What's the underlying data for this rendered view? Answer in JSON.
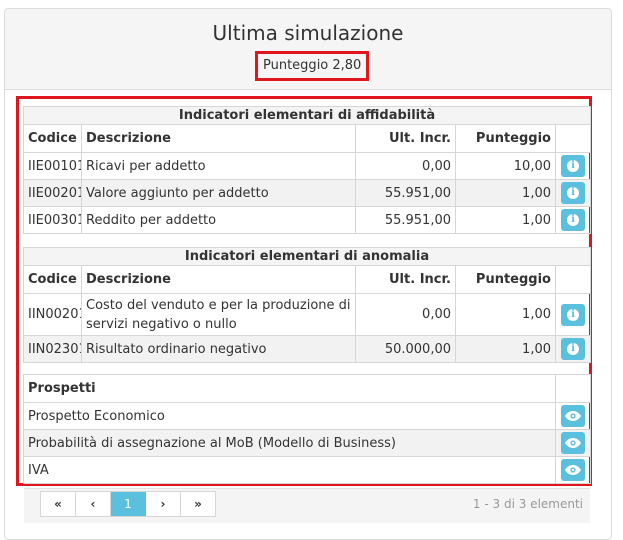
{
  "panel": {
    "title": "Ultima simulazione",
    "score": "Punteggio 2,80"
  },
  "affidabilita": {
    "section_title": "Indicatori elementari di affidabilità",
    "headers": {
      "code": "Codice",
      "desc": "Descrizione",
      "incr": "Ult. Incr.",
      "score": "Punteggio"
    },
    "rows": [
      {
        "code": "IIE00101",
        "desc": "Ricavi per addetto",
        "incr": "0,00",
        "score": "10,00"
      },
      {
        "code": "IIE00201",
        "desc": "Valore aggiunto per addetto",
        "incr": "55.951,00",
        "score": "1,00"
      },
      {
        "code": "IIE00301",
        "desc": "Reddito per addetto",
        "incr": "55.951,00",
        "score": "1,00"
      }
    ]
  },
  "anomalia": {
    "section_title": "Indicatori elementari di anomalia",
    "headers": {
      "code": "Codice",
      "desc": "Descrizione",
      "incr": "Ult. Incr.",
      "score": "Punteggio"
    },
    "rows": [
      {
        "code": "IIN00201",
        "desc": "Costo del venduto e per la produzione di servizi negativo o nullo",
        "incr": "0,00",
        "score": "1,00"
      },
      {
        "code": "IIN02301",
        "desc": "Risultato ordinario negativo",
        "incr": "50.000,00",
        "score": "1,00"
      }
    ]
  },
  "prospetti": {
    "title": "Prospetti",
    "items": [
      "Prospetto Economico",
      "Probabilità di assegnazione al MoB (Modello di Business)",
      "IVA"
    ]
  },
  "pagination": {
    "first": "«",
    "prev": "‹",
    "current": "1",
    "next": "›",
    "last": "»",
    "info": "1 - 3 di 3 elementi"
  },
  "icons": {
    "info": "info-icon",
    "view": "eye-icon"
  },
  "colors": {
    "accent": "#5bc0de",
    "highlight": "#e0161e"
  }
}
